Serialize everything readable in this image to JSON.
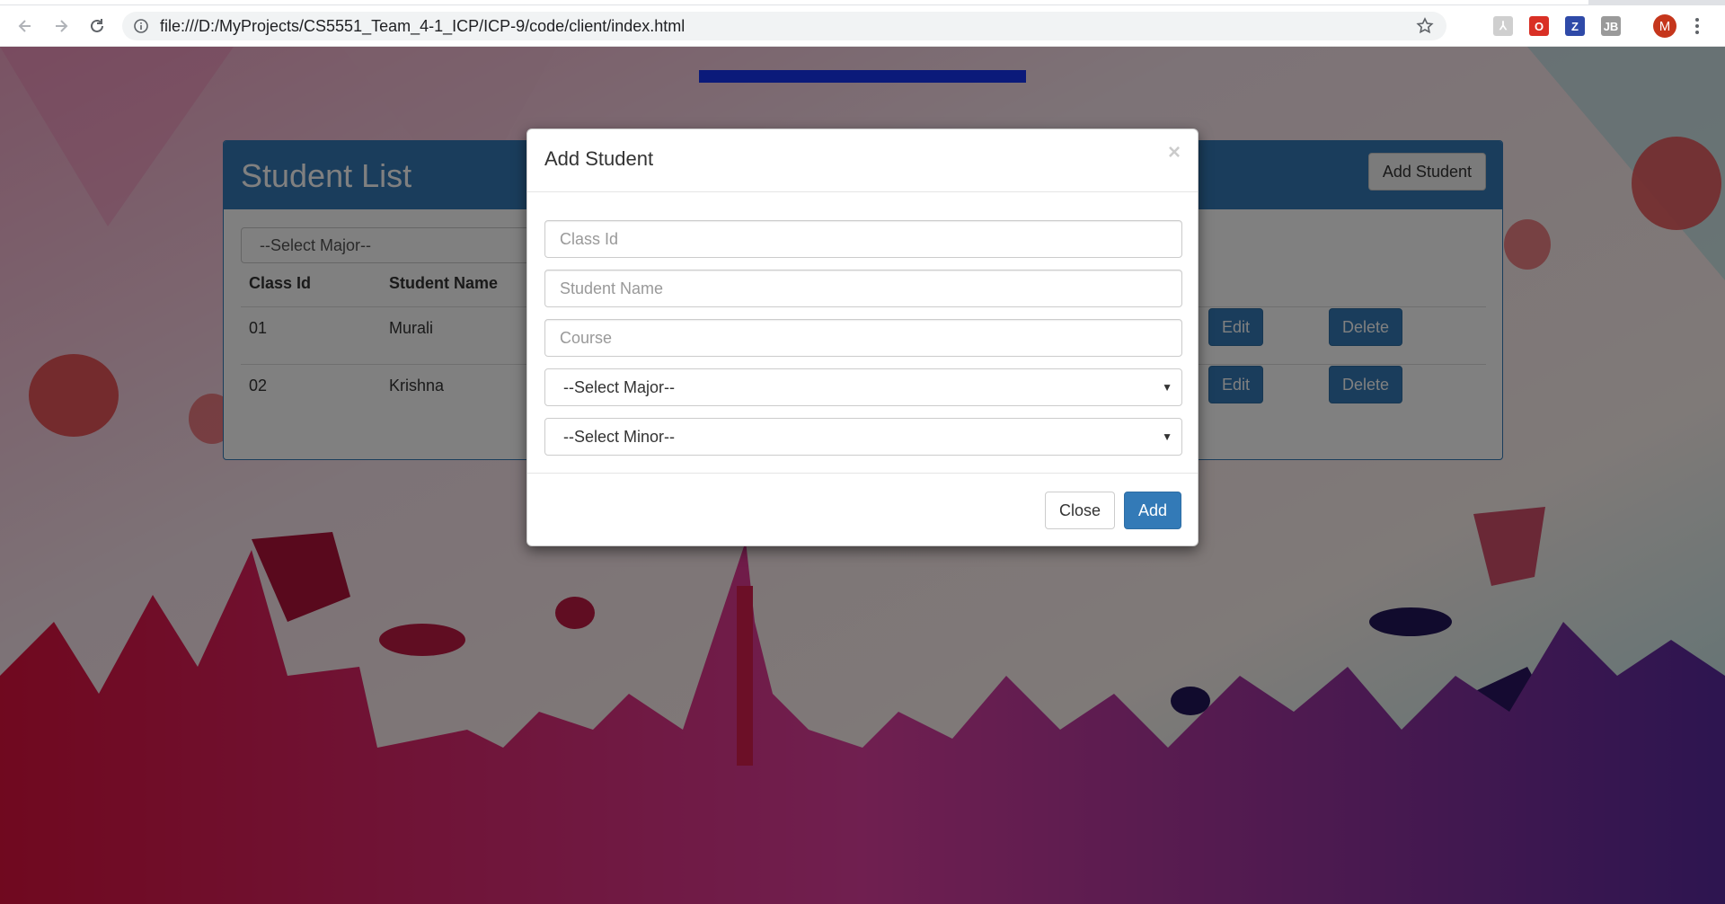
{
  "browser": {
    "url": "file:///D:/MyProjects/CS5551_Team_4-1_ICP/ICP-9/code/client/index.html",
    "avatar_letter": "M",
    "extensions": [
      {
        "icon": "pdf-extension-icon",
        "glyph": "⅄",
        "color": "#cfcfcf"
      },
      {
        "icon": "opera-extension-icon",
        "glyph": "O",
        "color": "#d93025"
      },
      {
        "icon": "z-extension-icon",
        "glyph": "Z",
        "color": "#2f4aa8"
      },
      {
        "icon": "jb-extension-icon",
        "glyph": "JB",
        "color": "#9a9a9a"
      }
    ]
  },
  "panel": {
    "title": "Student List",
    "add_button": "Add Student",
    "filter_major": "--Select Major--",
    "columns": [
      "Class Id",
      "Student Name"
    ],
    "rows": [
      {
        "class_id": "01",
        "student_name": "Murali",
        "edit": "Edit",
        "delete": "Delete"
      },
      {
        "class_id": "02",
        "student_name": "Krishna",
        "edit": "Edit",
        "delete": "Delete"
      }
    ]
  },
  "modal": {
    "title": "Add Student",
    "close_glyph": "×",
    "class_id_placeholder": "Class Id",
    "student_name_placeholder": "Student Name",
    "course_placeholder": "Course",
    "major_select": "--Select Major--",
    "minor_select": "--Select Minor--",
    "close_button": "Close",
    "add_button": "Add"
  },
  "colors": {
    "primary": "#337ab7",
    "overlay": "rgba(0,0,0,0.5)"
  }
}
